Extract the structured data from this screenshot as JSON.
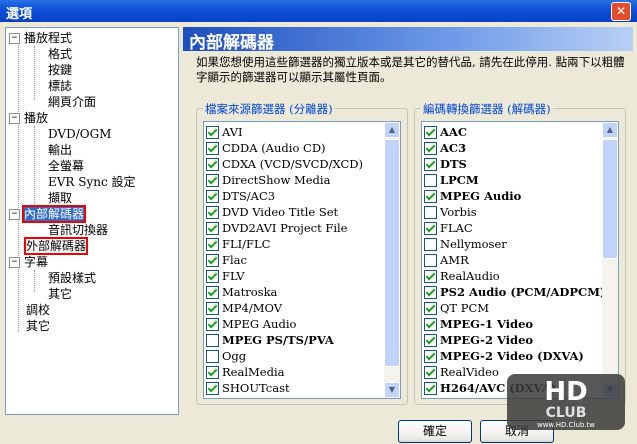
{
  "window": {
    "title": "選項",
    "close_label": "✕"
  },
  "tree": {
    "playback_settings": "播放程式",
    "format": "格式",
    "keys": "按鍵",
    "logo": "標誌",
    "web_interface": "網頁介面",
    "playback": "播放",
    "dvd_ogm": "DVD/OGM",
    "output": "輸出",
    "fullscreen": "全螢幕",
    "evr_sync": "EVR Sync 設定",
    "capture": "擷取",
    "internal_filters": "內部解碼器",
    "audio_switcher": "音訊切換器",
    "external_filters": "外部解碼器",
    "subtitles": "字幕",
    "default_style": "預設樣式",
    "misc_sub": "其它",
    "tweaks": "調校",
    "misc": "其它"
  },
  "header": {
    "title": "內部解碼器",
    "description": "如果您想使用這些篩選器的獨立版本或是其它的替代品, 請先在此停用. 點兩下以粗體字顯示的篩選器可以顯示其屬性頁面。"
  },
  "source_group": {
    "legend": "檔案來源篩選器 (分離器)",
    "items": [
      {
        "label": "AVI",
        "checked": true,
        "bold": false
      },
      {
        "label": "CDDA (Audio CD)",
        "checked": true,
        "bold": false
      },
      {
        "label": "CDXA (VCD/SVCD/XCD)",
        "checked": true,
        "bold": false
      },
      {
        "label": "DirectShow Media",
        "checked": true,
        "bold": false
      },
      {
        "label": "DTS/AC3",
        "checked": true,
        "bold": false
      },
      {
        "label": "DVD Video Title Set",
        "checked": true,
        "bold": false
      },
      {
        "label": "DVD2AVI Project File",
        "checked": true,
        "bold": false
      },
      {
        "label": "FLI/FLC",
        "checked": true,
        "bold": false
      },
      {
        "label": "Flac",
        "checked": true,
        "bold": false
      },
      {
        "label": "FLV",
        "checked": true,
        "bold": false
      },
      {
        "label": "Matroska",
        "checked": true,
        "bold": false
      },
      {
        "label": "MP4/MOV",
        "checked": true,
        "bold": false
      },
      {
        "label": "MPEG Audio",
        "checked": true,
        "bold": false
      },
      {
        "label": "MPEG PS/TS/PVA",
        "checked": false,
        "bold": true
      },
      {
        "label": "Ogg",
        "checked": false,
        "bold": false
      },
      {
        "label": "RealMedia",
        "checked": true,
        "bold": false
      },
      {
        "label": "SHOUTcast",
        "checked": true,
        "bold": false
      }
    ]
  },
  "transform_group": {
    "legend": "編碼轉換篩選器 (解碼器)",
    "items": [
      {
        "label": "AAC",
        "checked": true,
        "bold": true
      },
      {
        "label": "AC3",
        "checked": true,
        "bold": true
      },
      {
        "label": "DTS",
        "checked": true,
        "bold": true
      },
      {
        "label": "LPCM",
        "checked": false,
        "bold": true
      },
      {
        "label": "MPEG Audio",
        "checked": true,
        "bold": true
      },
      {
        "label": "Vorbis",
        "checked": false,
        "bold": false
      },
      {
        "label": "FLAC",
        "checked": true,
        "bold": false
      },
      {
        "label": "Nellymoser",
        "checked": false,
        "bold": false
      },
      {
        "label": "AMR",
        "checked": false,
        "bold": false
      },
      {
        "label": "RealAudio",
        "checked": true,
        "bold": false
      },
      {
        "label": "PS2 Audio (PCM/ADPCM)",
        "checked": true,
        "bold": true
      },
      {
        "label": "QT PCM",
        "checked": true,
        "bold": false
      },
      {
        "label": "MPEG-1 Video",
        "checked": true,
        "bold": true
      },
      {
        "label": "MPEG-2 Video",
        "checked": true,
        "bold": true
      },
      {
        "label": "MPEG-2 Video (DXVA)",
        "checked": true,
        "bold": true
      },
      {
        "label": "RealVideo",
        "checked": true,
        "bold": false
      },
      {
        "label": "H264/AVC (DXVA)",
        "checked": true,
        "bold": true
      }
    ]
  },
  "buttons": {
    "ok": "確定",
    "cancel": "取消"
  },
  "logo": {
    "top": "HD",
    "bottom": "CLUB",
    "url": "www.HD.Club.tw"
  }
}
